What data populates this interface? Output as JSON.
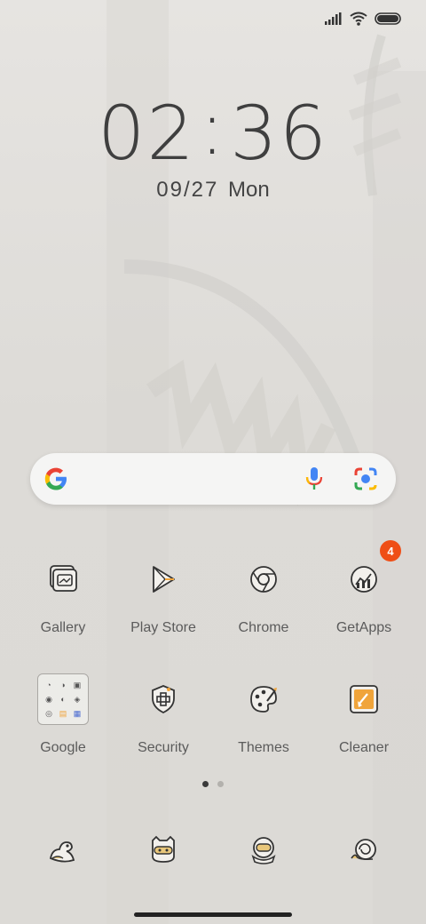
{
  "lockscreen": {
    "clock_hours": "02",
    "clock_minutes": "36",
    "date": "09/27",
    "weekday": "Mon"
  },
  "status_bar": {
    "icons": [
      "signal-icon",
      "wifi-icon",
      "battery-icon"
    ]
  },
  "search_widget": {
    "icons": [
      "google-g-icon",
      "microphone-icon",
      "google-lens-icon"
    ]
  },
  "apps": [
    {
      "label": "Gallery",
      "icon": "gallery-icon"
    },
    {
      "label": "Play Store",
      "icon": "play-store-icon"
    },
    {
      "label": "Chrome",
      "icon": "chrome-icon"
    },
    {
      "label": "GetApps",
      "icon": "getapps-icon",
      "badge": "4"
    },
    {
      "label": "Google",
      "icon": "google-folder-icon"
    },
    {
      "label": "Security",
      "icon": "security-icon"
    },
    {
      "label": "Themes",
      "icon": "themes-icon"
    },
    {
      "label": "Cleaner",
      "icon": "cleaner-icon"
    }
  ],
  "page_indicator": {
    "count": 2,
    "active": 0
  },
  "dock": {
    "icons": [
      "dinosaur-icon",
      "ninja-icon",
      "astronaut-icon",
      "snail-icon"
    ]
  },
  "colors": {
    "badge": "#ef4e16",
    "accent_orange": "#f0a43a"
  }
}
